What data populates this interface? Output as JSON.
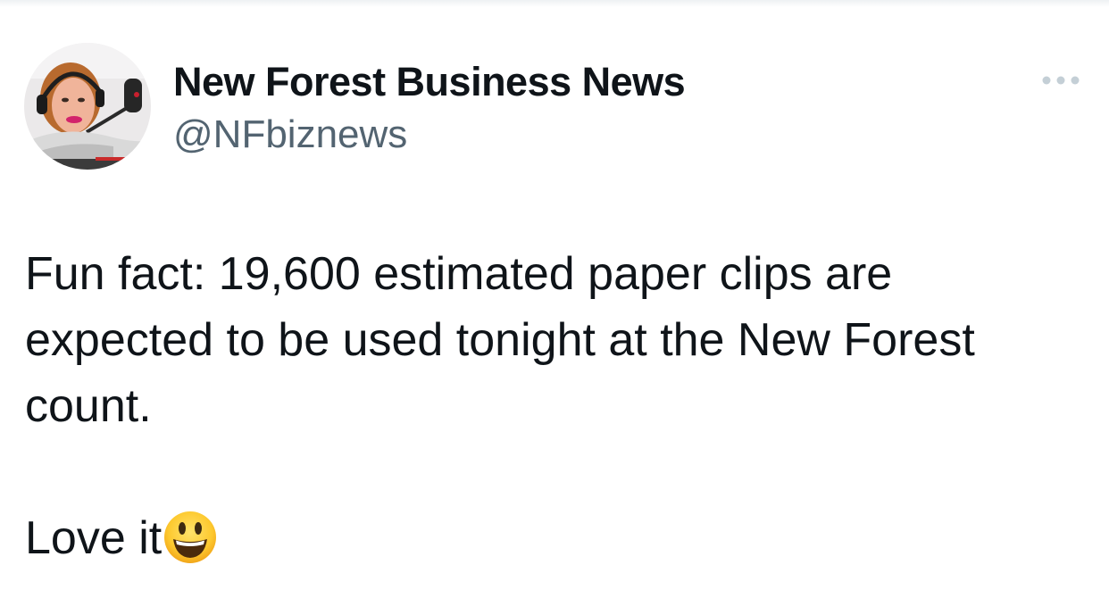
{
  "author": {
    "display_name": "New Forest Business News",
    "handle": "@NFbiznews",
    "avatar_icon": "profile-photo-woman-headset"
  },
  "more_menu": {
    "icon": "more-horizontal-icon"
  },
  "tweet": {
    "paragraph_1": "Fun fact: 19,600 estimated paper clips are expected to be used tonight at the New Forest count.",
    "paragraph_2": "Love it",
    "emoji": "grinning-face-icon"
  },
  "colors": {
    "text_primary": "#0f1419",
    "text_secondary": "#536471",
    "background": "#ffffff"
  }
}
